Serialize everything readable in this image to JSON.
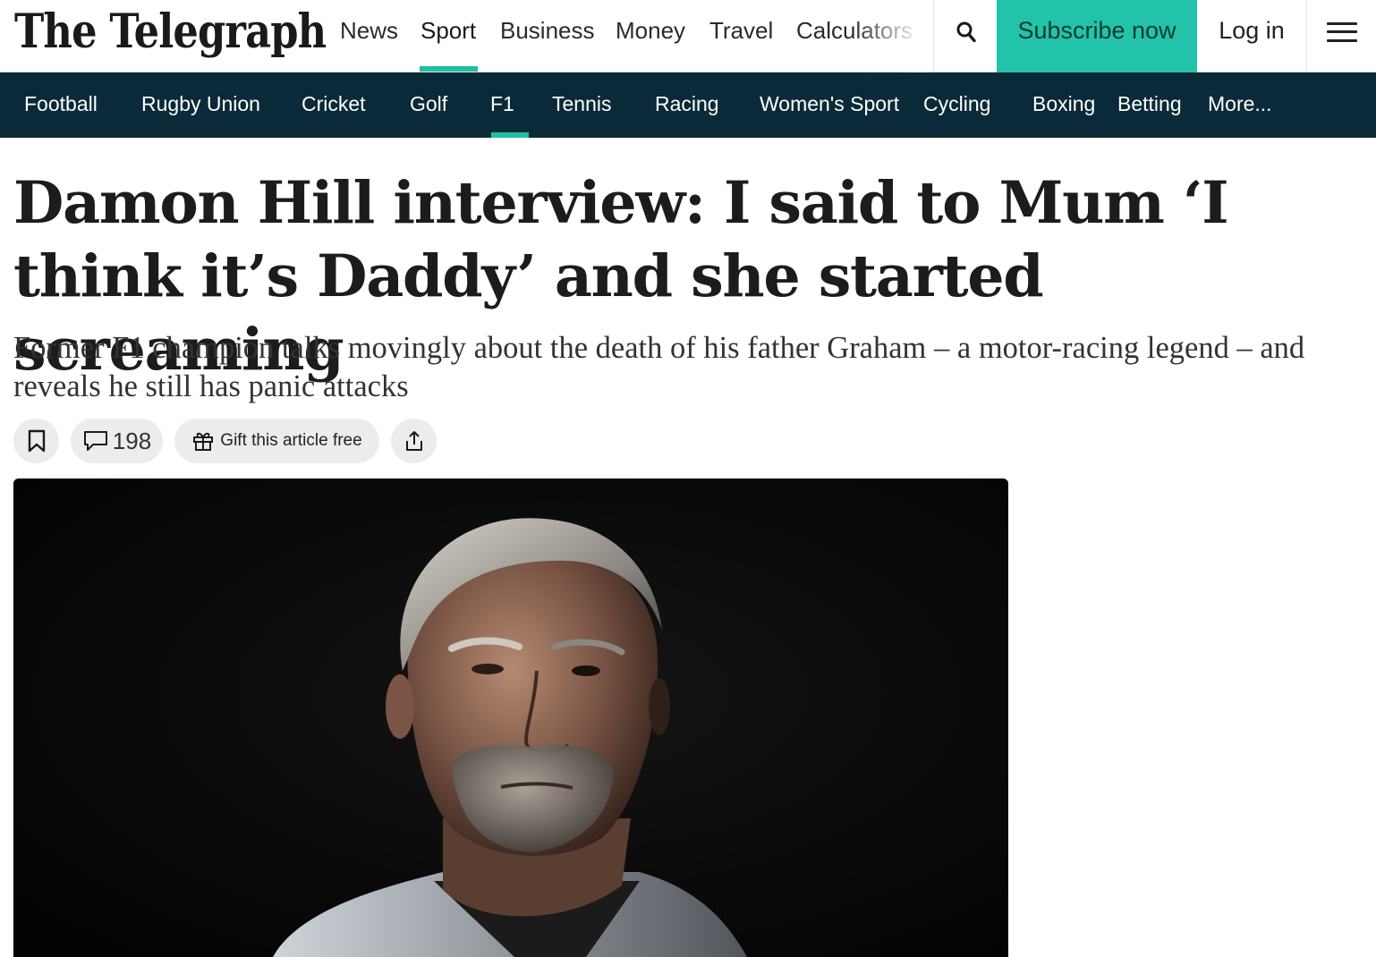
{
  "header": {
    "logo_text": "The Telegraph",
    "nav": [
      {
        "label": "News"
      },
      {
        "label": "Sport",
        "active": true
      },
      {
        "label": "Business"
      },
      {
        "label": "Money"
      },
      {
        "label": "Travel"
      },
      {
        "label": "Calculators"
      }
    ],
    "search_icon": "search-icon",
    "subscribe_label": "Subscribe now",
    "login_label": "Log in",
    "menu_icon": "hamburger-menu-icon",
    "accent_color": "#23c3aa"
  },
  "sport_nav": {
    "items": [
      {
        "label": "Football"
      },
      {
        "label": "Rugby Union"
      },
      {
        "label": "Cricket"
      },
      {
        "label": "Golf"
      },
      {
        "label": "F1",
        "active": true
      },
      {
        "label": "Tennis"
      },
      {
        "label": "Racing"
      },
      {
        "label": "Women's Sport"
      },
      {
        "label": "Cycling"
      },
      {
        "label": "Boxing"
      },
      {
        "label": "Betting"
      },
      {
        "label": "More..."
      }
    ],
    "background_color": "#0b2a39"
  },
  "article": {
    "headline": "Damon Hill interview: I said to Mum ‘I think it’s Daddy’ and she started screaming",
    "standfirst": "Former F1 champion talks movingly about the death of his father Graham – a motor-racing legend – and reveals he still has panic attacks",
    "actions": {
      "bookmark_icon": "bookmark-icon",
      "comment_icon": "comment-icon",
      "comment_count": "198",
      "gift_icon": "gift-icon",
      "gift_label": "Gift this article free",
      "share_icon": "share-icon"
    }
  }
}
